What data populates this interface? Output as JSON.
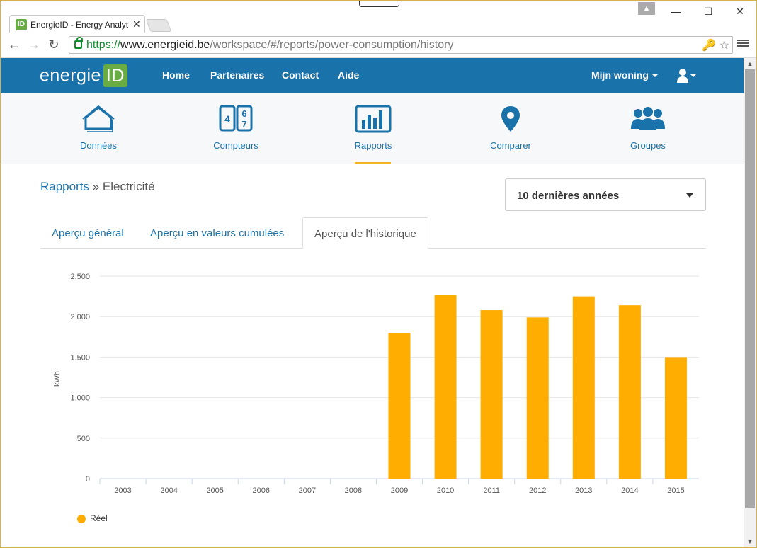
{
  "browser": {
    "tab_title": "EnergieID - Energy Analyt",
    "favicon_text": "ID",
    "url_scheme": "https://",
    "url_host": "www.energieid.be",
    "url_path": "/workspace/#/reports/power-consumption/history"
  },
  "site_nav": {
    "logo_text": "energie",
    "logo_box": "ID",
    "links": [
      "Home",
      "Partenaires",
      "Contact",
      "Aide"
    ],
    "account": "Mijn woning"
  },
  "sub_nav": {
    "items": [
      {
        "label": "Données",
        "icon": "house-icon"
      },
      {
        "label": "Compteurs",
        "icon": "meter-icon"
      },
      {
        "label": "Rapports",
        "icon": "bar-chart-icon"
      },
      {
        "label": "Comparer",
        "icon": "map-pin-icon"
      },
      {
        "label": "Groupes",
        "icon": "group-icon"
      }
    ],
    "active": "Rapports",
    "meter_digits": [
      "4",
      "6",
      "7"
    ]
  },
  "breadcrumb": {
    "link": "Rapports",
    "separator": "»",
    "current": "Electricité"
  },
  "period_select": {
    "value": "10 dernières années"
  },
  "tabs": [
    {
      "label": "Aperçu général",
      "active": false
    },
    {
      "label": "Aperçu en valeurs cumulées",
      "active": false
    },
    {
      "label": "Aperçu de l'historique",
      "active": true
    }
  ],
  "colors": {
    "brand_blue": "#1a72aa",
    "brand_green": "#6aac44",
    "bar": "#ffad00",
    "active_tab_bar": "#f6b323"
  },
  "chart_data": {
    "type": "bar",
    "title": "",
    "xlabel": "",
    "ylabel": "kWh",
    "categories": [
      "2003",
      "2004",
      "2005",
      "2006",
      "2007",
      "2008",
      "2009",
      "2010",
      "2011",
      "2012",
      "2013",
      "2014",
      "2015"
    ],
    "series": [
      {
        "name": "Réel",
        "values": [
          0,
          0,
          0,
          0,
          0,
          0,
          1800,
          2270,
          2080,
          1990,
          2250,
          2140,
          1500
        ]
      }
    ],
    "ylim": [
      0,
      2500
    ],
    "yticks": [
      0,
      500,
      1000,
      1500,
      2000,
      2500
    ],
    "ytick_labels": [
      "0",
      "500",
      "1.000",
      "1.500",
      "2.000",
      "2.500"
    ],
    "grid": true,
    "legend": "bottom-left"
  }
}
